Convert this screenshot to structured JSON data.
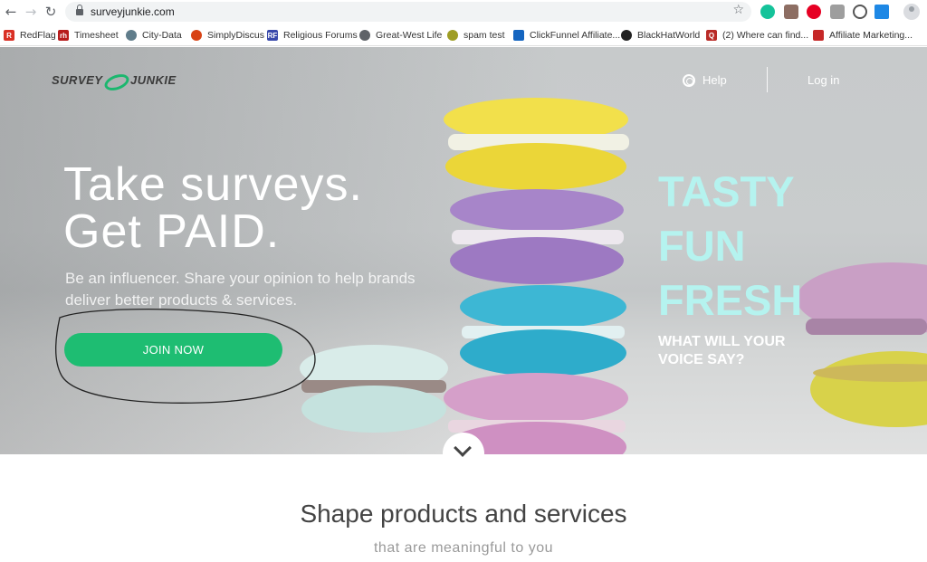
{
  "browser": {
    "url": "surveyjunkie.com",
    "bookmarks": [
      {
        "label": "RedFlag",
        "icon": "redflag-icon",
        "color": "#d93025"
      },
      {
        "label": "Timesheet",
        "icon": "rh-icon",
        "color": "#b71c1c"
      },
      {
        "label": "City-Data",
        "icon": "citydata-icon",
        "color": "#607d8b"
      },
      {
        "label": "SimplyDiscus",
        "icon": "discus-icon",
        "color": "#d84315"
      },
      {
        "label": "Religious Forums",
        "icon": "rf-icon",
        "color": "#3949ab"
      },
      {
        "label": "Great-West Life",
        "icon": "globe-icon",
        "color": "#5f6368"
      },
      {
        "label": "spam test",
        "icon": "leaf-icon",
        "color": "#9e9d24"
      },
      {
        "label": "ClickFunnel Affiliate...",
        "icon": "clickfunnel-icon",
        "color": "#1565c0"
      },
      {
        "label": "BlackHatWorld",
        "icon": "bhw-icon",
        "color": "#212121"
      },
      {
        "label": "(2) Where can find...",
        "icon": "quora-icon",
        "color": "#b92b27"
      },
      {
        "label": "Affiliate Marketing...",
        "icon": "youtube-icon",
        "color": "#c62828"
      }
    ],
    "extensions": [
      "grammarly-icon",
      "extension-icon",
      "pinterest-icon",
      "screenshot-icon",
      "magnifier-icon",
      "puzzle-icon",
      "kite-icon"
    ]
  },
  "header": {
    "logo_left": "SURVEY",
    "logo_right": "JUNKIE",
    "help_label": "Help",
    "login_label": "Log in"
  },
  "hero": {
    "headline_line1": "Take surveys.",
    "headline_line2": "Get PAID.",
    "subline_line1": "Be an influencer. Share your opinion to help brands",
    "subline_line2": "deliver better products & services.",
    "cta_label": "JOIN NOW",
    "tagline": [
      "TASTY",
      "FUN",
      "FRESH"
    ],
    "question_line1": "WHAT WILL YOUR",
    "question_line2": "VOICE SAY?"
  },
  "section": {
    "title": "Shape products and services",
    "subtitle": "that are meaningful to you"
  },
  "colors": {
    "accent_green": "#1ebd72",
    "tagline_cyan": "#b5f3ef"
  }
}
